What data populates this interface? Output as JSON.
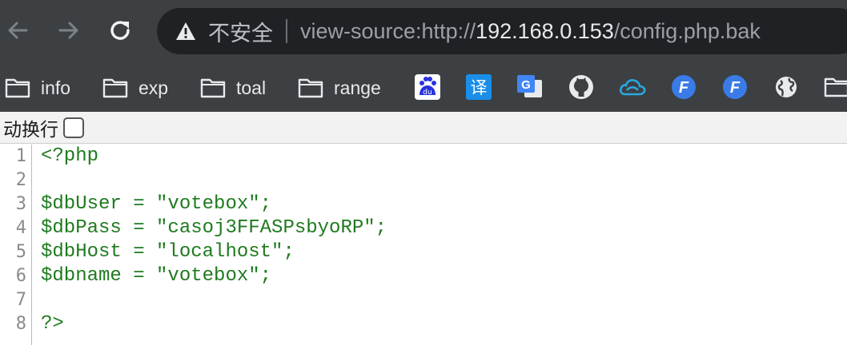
{
  "browser": {
    "back_icon": "arrow-left-icon",
    "forward_icon": "arrow-right-icon",
    "reload_icon": "reload-icon",
    "security_warning_icon": "warning-triangle-icon",
    "security_label": "不安全",
    "url": {
      "prefix": "view-source:http://",
      "host": "192.168.0.153",
      "path": "/config.php.bak"
    }
  },
  "bookmarks": [
    {
      "label": "info",
      "icon": "folder-icon"
    },
    {
      "label": "exp",
      "icon": "folder-icon"
    },
    {
      "label": "toal",
      "icon": "folder-icon"
    },
    {
      "label": "range",
      "icon": "folder-icon"
    }
  ],
  "bookmark_icons": {
    "baidu": "du",
    "translate": "译",
    "google_translate": "G",
    "fofa_1": "F",
    "fofa_2": "F"
  },
  "view_source": {
    "line_wrap_label": "动换行",
    "line_wrap_checked": false,
    "lines": [
      {
        "num": "1",
        "text": "<?php"
      },
      {
        "num": "2",
        "text": ""
      },
      {
        "num": "3",
        "text": "$dbUser = \"votebox\";"
      },
      {
        "num": "4",
        "text": "$dbPass = \"casoj3FFASPsbyoRP\";"
      },
      {
        "num": "5",
        "text": "$dbHost = \"localhost\";"
      },
      {
        "num": "6",
        "text": "$dbname = \"votebox\";"
      },
      {
        "num": "7",
        "text": ""
      },
      {
        "num": "8",
        "text": "?>"
      }
    ]
  },
  "colors": {
    "chrome_dark": "#3c4043",
    "omnibox": "#202124",
    "code_green": "#1f7a1f",
    "line_number": "#8a8a8a"
  }
}
